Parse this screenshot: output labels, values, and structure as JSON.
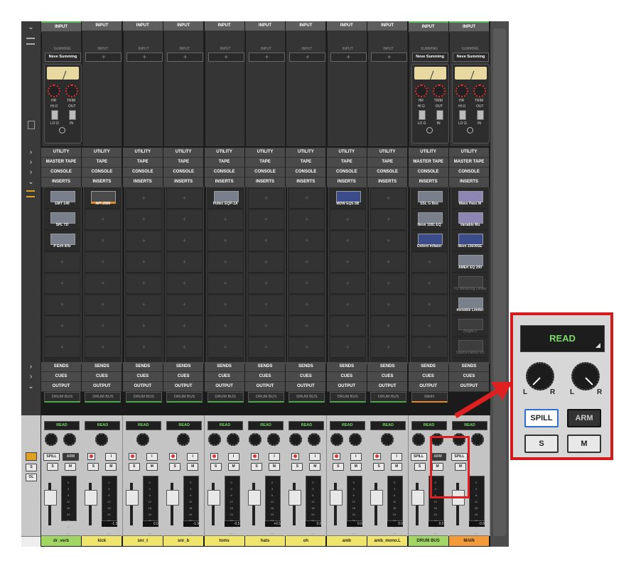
{
  "section_labels": {
    "input": "INPUT",
    "summing": "SUMMING",
    "utility": "UTILITY",
    "master_tape": "MASTER TAPE",
    "tape": "TAPE",
    "console": "CONSOLE",
    "inserts": "INSERTS",
    "sends": "SENDS",
    "cues": "CUES",
    "output": "OUTPUT"
  },
  "summing_plugin": {
    "label": "Neve Summing",
    "hr": "HR",
    "trim": "TRIM",
    "hi": "HI Ω",
    "out": "OUT",
    "lo": "LO Ω",
    "in": "IN"
  },
  "empty_slot": "+",
  "channels": [
    {
      "name": "dr_verb",
      "color": "green",
      "has_summing": true,
      "tape": "MASTER TAPE",
      "inserts": [
        "EMT 140",
        "SPL TD",
        "P Enh kHz"
      ],
      "output": "DRUM BUS",
      "gain": "",
      "mono": false
    },
    {
      "name": "kick",
      "color": "yellow",
      "has_summing": false,
      "tape": "TAPE",
      "inserts": [
        "API 2500"
      ],
      "output": "DRUM BUS",
      "gain": "-1.5",
      "mono": true
    },
    {
      "name": "snr_t",
      "color": "yellow",
      "has_summing": false,
      "tape": "TAPE",
      "inserts": [],
      "output": "DRUM BUS",
      "gain": "0.0",
      "mono": true
    },
    {
      "name": "snr_b",
      "color": "yellow",
      "has_summing": false,
      "tape": "TAPE",
      "inserts": [],
      "output": "DRUM BUS",
      "gain": "-1.9",
      "mono": true
    },
    {
      "name": "toms",
      "color": "yellow",
      "has_summing": false,
      "tape": "TAPE",
      "inserts": [
        "Pultec EQP-1A"
      ],
      "output": "DRUM BUS",
      "gain": "-0.5",
      "mono": false
    },
    {
      "name": "hats",
      "color": "yellow",
      "has_summing": false,
      "tape": "TAPE",
      "inserts": [],
      "output": "DRUM BUS",
      "gain": "+0.5",
      "mono": false
    },
    {
      "name": "oh",
      "color": "yellow",
      "has_summing": false,
      "tape": "TAPE",
      "inserts": [],
      "output": "DRUM BUS",
      "gain": "0.0",
      "mono": false
    },
    {
      "name": "amb",
      "color": "yellow",
      "has_summing": false,
      "tape": "TAPE",
      "inserts": [
        "MDW EQ5-3B"
      ],
      "output": "DRUM BUS",
      "gain": "0.0",
      "mono": false
    },
    {
      "name": "amb_mono.L",
      "color": "yellow",
      "has_summing": false,
      "tape": "TAPE",
      "inserts": [],
      "output": "DRUM BUS",
      "gain": "0.0",
      "mono": true
    },
    {
      "name": "DRUM BUS",
      "color": "green",
      "has_summing": true,
      "tape": "MASTER TAPE",
      "inserts": [
        "SSL G Bus",
        "Neve 1081 EQ",
        "Oxford Inflator"
      ],
      "output": "MAIN",
      "gain": "0.0",
      "mono": false,
      "bus": true
    },
    {
      "name": "MAIN",
      "color": "orange",
      "has_summing": true,
      "tape": "MASTER TAPE",
      "inserts": [
        "Mass Pass M",
        "Variable Mu",
        "Neve 33609SE",
        "AMEK EQ 200",
        "TG Mastering Limiter",
        "Invisible Limiter",
        "Insight 2",
        "Source-Nexus I/O"
      ],
      "dim_inserts": [
        4,
        6,
        7
      ],
      "output": "",
      "gain": "-0.8",
      "mono": false,
      "master": true
    }
  ],
  "automation": "READ",
  "buttons": {
    "spill": "SPILL",
    "arm": "ARM",
    "solo": "S",
    "mute": "M",
    "input": "I"
  },
  "pan": {
    "left": "L",
    "right": "R"
  },
  "left_controls": {
    "solo": "S",
    "output_lock": "OL"
  },
  "meter_ticks": [
    "0",
    "3",
    "6",
    "12",
    "18",
    "24",
    "36",
    "50",
    "60"
  ],
  "zoom": {
    "read": "READ",
    "spill": "SPILL",
    "arm": "ARM",
    "solo": "S",
    "mute": "M",
    "left": "L",
    "right": "R"
  },
  "colors": {
    "green": "#a2d664",
    "yellow": "#f0e56c",
    "orange": "#f39a39",
    "read_text": "#7dd96a",
    "highlight": "#e02020"
  }
}
